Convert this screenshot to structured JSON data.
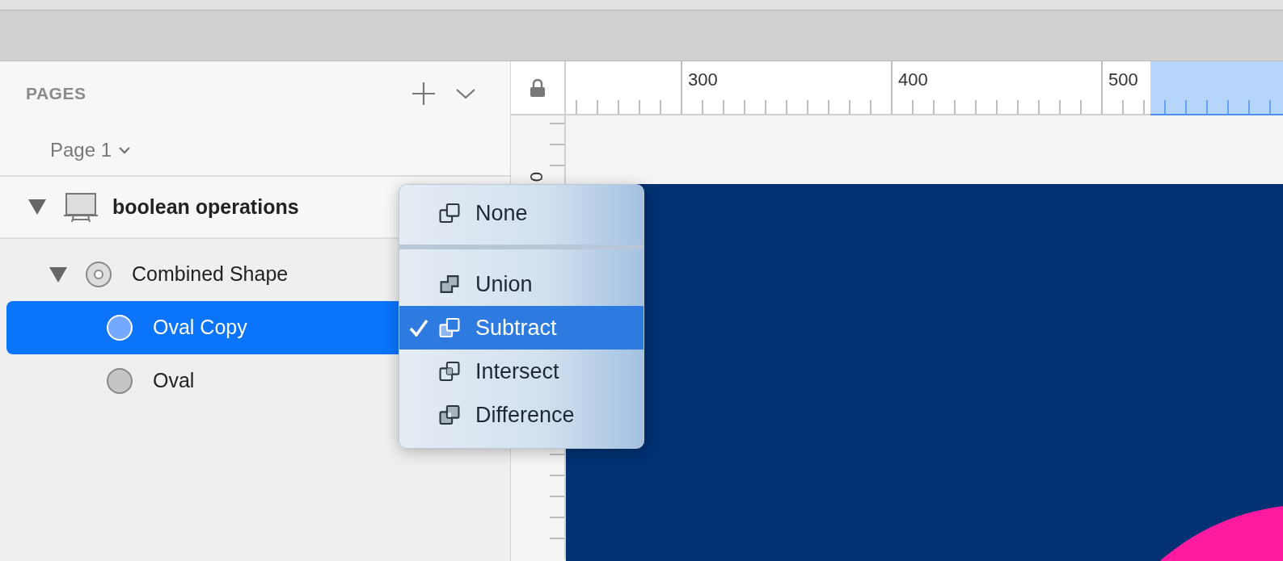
{
  "pages_panel": {
    "title": "PAGES",
    "current_page": "Page 1"
  },
  "layers": [
    {
      "name": "boolean operations",
      "kind": "artboard",
      "expanded": true,
      "selected": false,
      "children": [
        {
          "name": "Combined Shape",
          "kind": "combined",
          "expanded": true,
          "selected": false,
          "children": [
            {
              "name": "Oval Copy",
              "kind": "oval",
              "selected": true
            },
            {
              "name": "Oval",
              "kind": "oval",
              "selected": false
            }
          ]
        }
      ]
    }
  ],
  "ruler": {
    "labels": [
      "300",
      "400",
      "500"
    ],
    "vertical_labels": [
      "0"
    ]
  },
  "boolean_menu": {
    "items": [
      {
        "label": "None",
        "kind": "none",
        "selected": false,
        "separator_after": true
      },
      {
        "label": "Union",
        "kind": "union",
        "selected": false,
        "separator_after": false
      },
      {
        "label": "Subtract",
        "kind": "subtract",
        "selected": true,
        "separator_after": false
      },
      {
        "label": "Intersect",
        "kind": "intersect",
        "selected": false,
        "separator_after": false
      },
      {
        "label": "Difference",
        "kind": "difference",
        "selected": false,
        "separator_after": false
      }
    ]
  }
}
